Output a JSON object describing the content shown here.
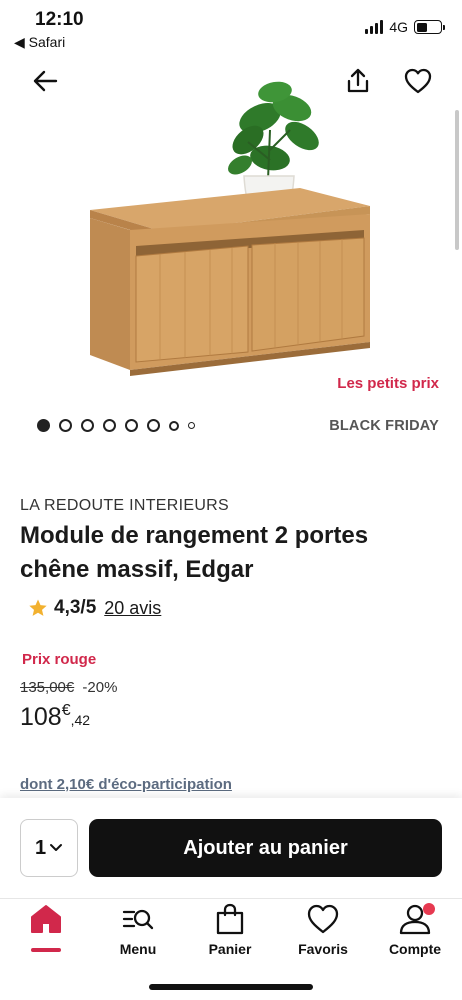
{
  "status_bar": {
    "time": "12:10",
    "back_app": "◀ Safari",
    "network": "4G",
    "battery_level": 0.45
  },
  "header": {
    "back_icon": "arrow-left-icon",
    "share_icon": "share-icon",
    "favorite_icon": "heart-icon"
  },
  "gallery": {
    "promo_tag": "Les petits prix",
    "event_tag": "BLACK FRIDAY",
    "dots_total": 8,
    "active_dot": 1
  },
  "product": {
    "brand": "LA REDOUTE INTERIEURS",
    "title": "Module de rangement 2 portes chêne massif, Edgar",
    "rating": "4,3/5",
    "reviews": "20 avis",
    "price_label": "Prix rouge",
    "old_price": "135,00€",
    "discount": "-20%",
    "price_int": "108",
    "price_currency": "€",
    "price_dec": ",42",
    "eco_participation": "dont 2,10€ d'éco-participation"
  },
  "actions": {
    "quantity": "1",
    "add_to_cart": "Ajouter au panier"
  },
  "tabbar": {
    "items": [
      {
        "label": "",
        "icon": "home-icon"
      },
      {
        "label": "Menu",
        "icon": "menu-search-icon"
      },
      {
        "label": "Panier",
        "icon": "bag-icon"
      },
      {
        "label": "Favoris",
        "icon": "heart-icon"
      },
      {
        "label": "Compte",
        "icon": "user-icon"
      }
    ]
  },
  "colors": {
    "accent": "#d1284b",
    "button": "#111111",
    "eco_link": "#5c6b80"
  }
}
